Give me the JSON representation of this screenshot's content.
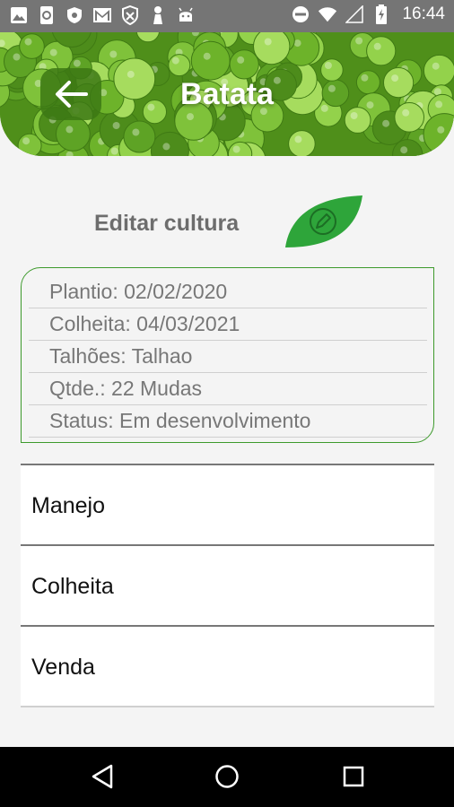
{
  "status_bar": {
    "time": "16:44",
    "left_icons": [
      "image-icon",
      "phone-sync-icon",
      "shield-icon",
      "gmail-icon",
      "shield-outline-icon",
      "person-icon",
      "android-icon"
    ],
    "right_icons": [
      "do-not-disturb-icon",
      "wifi-icon",
      "signal-icon",
      "battery-charging-icon"
    ]
  },
  "header": {
    "title": "Batata",
    "back_icon": "arrow-left-icon"
  },
  "edit": {
    "label": "Editar cultura",
    "icon": "pencil-icon"
  },
  "info": {
    "plantio": "Plantio: 02/02/2020",
    "colheita": "Colheita: 04/03/2021",
    "talhoes": "Talhões: Talhao",
    "qtde": "Qtde.: 22 Mudas",
    "status": "Status: Em desenvolvimento"
  },
  "menu": {
    "items": [
      {
        "label": "Manejo"
      },
      {
        "label": "Colheita"
      },
      {
        "label": "Venda"
      }
    ]
  },
  "nav_bar": {
    "back": "back-triangle-icon",
    "home": "home-circle-icon",
    "recents": "recents-square-icon"
  },
  "colors": {
    "accent_green": "#3d9a2c",
    "leaf_green": "#2ea53a",
    "status_bar": "#757575"
  }
}
